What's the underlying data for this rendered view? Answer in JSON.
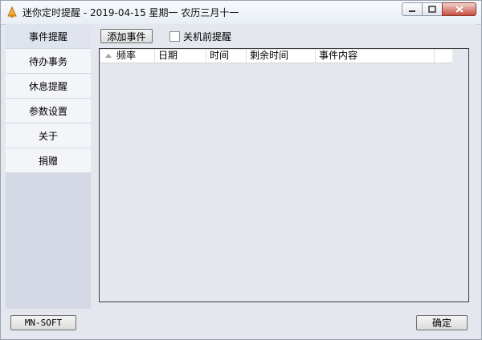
{
  "window": {
    "title": "迷你定时提醒 - 2019-04-15 星期一 农历三月十一"
  },
  "sidebar": {
    "items": [
      {
        "label": "事件提醒",
        "active": true
      },
      {
        "label": "待办事务"
      },
      {
        "label": "休息提醒"
      },
      {
        "label": "参数设置"
      },
      {
        "label": "关于"
      },
      {
        "label": "捐赠"
      }
    ]
  },
  "toolbar": {
    "add_event_label": "添加事件",
    "shutdown_reminder_label": "关机前提醒",
    "shutdown_reminder_checked": false
  },
  "event_table": {
    "columns": [
      "频率",
      "日期",
      "时间",
      "剩余时间",
      "事件内容"
    ],
    "rows": []
  },
  "footer": {
    "brand_button_label": "MN-SOFT",
    "confirm_label": "确定"
  },
  "colors": {
    "window_background": "#e5e7ef",
    "sidebar_background": "#d5d9e6",
    "close_button": "#c74f3f"
  },
  "icons": {
    "app": "bell-clock-icon",
    "minimize": "minimize-icon",
    "maximize": "maximize-icon",
    "close": "close-icon"
  }
}
